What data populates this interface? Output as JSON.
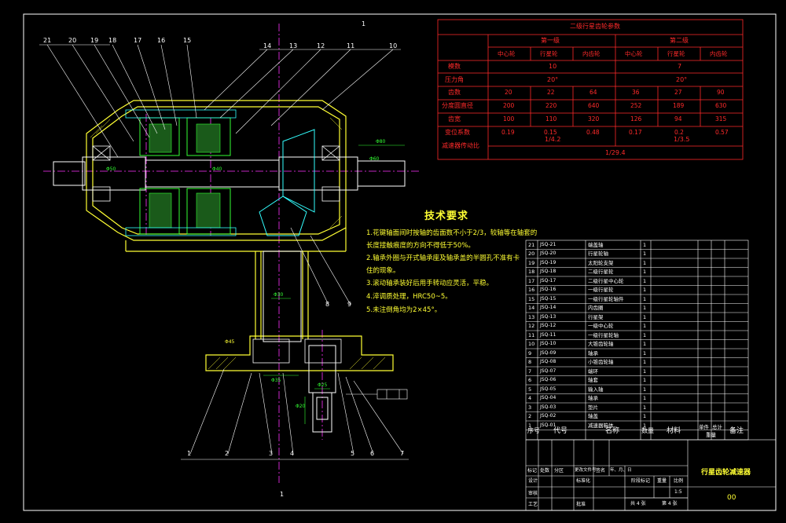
{
  "colors": {
    "background": "#000000",
    "frame": "#ffffff",
    "red": "#ff2a2a",
    "yellow": "#ffff33",
    "green": "#33ff33",
    "cyan": "#33ffff",
    "magenta": "#ff33ff"
  },
  "top_mark": "1",
  "bottom_mark": "1",
  "gear_table": {
    "title": "二级行星齿轮参数",
    "stage1": "第一级",
    "stage2": "第二级",
    "sub_headers": [
      "中心轮",
      "行星轮",
      "内齿轮",
      "中心轮",
      "行星轮",
      "内齿轮"
    ],
    "rows": [
      {
        "label": "模数",
        "cells": [
          "10",
          "7"
        ]
      },
      {
        "label": "压力角",
        "cells": [
          "20°",
          "20°"
        ]
      },
      {
        "label": "齿数",
        "cells": [
          "20",
          "22",
          "64",
          "36",
          "27",
          "90"
        ]
      },
      {
        "label": "分度圆直径",
        "cells": [
          "200",
          "220",
          "640",
          "252",
          "189",
          "630"
        ]
      },
      {
        "label": "齿宽",
        "cells": [
          "100",
          "110",
          "320",
          "126",
          "94",
          "315"
        ]
      },
      {
        "label": "变位系数",
        "cells": [
          "0.19",
          "0.15",
          "0.48",
          "0.17",
          "0.2",
          "0.57"
        ]
      }
    ],
    "ratio_label": "减速器传动比",
    "ratio_stage1": "1/4.2",
    "ratio_stage2": "1/3.5",
    "ratio_total": "1/29.4"
  },
  "tech": {
    "title": "技术要求",
    "lines": [
      "1.花键轴面间时按轴的齿面数不小于2/3，较轴等在轴套的",
      "长度接触痕度的方向不得低于50%。",
      "2.轴承外圈与开式轴承座及轴承盖的半圆孔不准有卡",
      "住的现象。",
      "3.滚动轴承装好后用手转动应灵活，平稳。",
      "4.淬调质处理，HRC50~5。",
      "5.未注倒角均为2×45°。"
    ]
  },
  "callouts_top": [
    "21",
    "20",
    "19",
    "18",
    "17",
    "16",
    "15",
    "14",
    "13",
    "12",
    "11",
    "10"
  ],
  "callouts_bottom": [
    "1",
    "2",
    "3",
    "4",
    "5",
    "6",
    "7"
  ],
  "callouts_mid": [
    "8",
    "9"
  ],
  "bom": [
    {
      "no": "21",
      "code": "JSQ-21",
      "name": "端盖轴",
      "qty": "1"
    },
    {
      "no": "20",
      "code": "JSQ-20",
      "name": "行星轮轴",
      "qty": "1"
    },
    {
      "no": "19",
      "code": "JSQ-19",
      "name": "太阳轮支架",
      "qty": "1"
    },
    {
      "no": "18",
      "code": "JSQ-18",
      "name": "二级行星轮",
      "qty": "1"
    },
    {
      "no": "17",
      "code": "JSQ-17",
      "name": "二级行星中心轮",
      "qty": "1"
    },
    {
      "no": "16",
      "code": "JSQ-16",
      "name": "一级行星轮",
      "qty": "1"
    },
    {
      "no": "15",
      "code": "JSQ-15",
      "name": "一级行星轮轴件",
      "qty": "1"
    },
    {
      "no": "14",
      "code": "JSQ-14",
      "name": "内齿圈",
      "qty": "1"
    },
    {
      "no": "13",
      "code": "JSQ-13",
      "name": "行星架",
      "qty": "1"
    },
    {
      "no": "12",
      "code": "JSQ-12",
      "name": "一级中心轮",
      "qty": "1"
    },
    {
      "no": "11",
      "code": "JSQ-11",
      "name": "一级行星轮轴",
      "qty": "1"
    },
    {
      "no": "10",
      "code": "JSQ-10",
      "name": "大锥齿轮轴",
      "qty": "1"
    },
    {
      "no": "9",
      "code": "JSQ-09",
      "name": "轴承",
      "qty": "1"
    },
    {
      "no": "8",
      "code": "JSQ-08",
      "name": "小锥齿轮轴",
      "qty": "1"
    },
    {
      "no": "7",
      "code": "JSQ-07",
      "name": "端环",
      "qty": "1"
    },
    {
      "no": "6",
      "code": "JSQ-06",
      "name": "轴套",
      "qty": "1"
    },
    {
      "no": "5",
      "code": "JSQ-05",
      "name": "输入轴",
      "qty": "1"
    },
    {
      "no": "4",
      "code": "JSQ-04",
      "name": "轴承",
      "qty": "1"
    },
    {
      "no": "3",
      "code": "JSQ-03",
      "name": "垫片",
      "qty": "1"
    },
    {
      "no": "2",
      "code": "JSQ-02",
      "name": "轴盖",
      "qty": "1"
    },
    {
      "no": "1",
      "code": "JSQ-01",
      "name": "减速器箱体",
      "qty": "1"
    }
  ],
  "bom_header": {
    "no": "序号",
    "code": "代号",
    "name": "名称",
    "qty": "数量",
    "material": "材料",
    "unit_weight": "单件",
    "total_weight": "总计",
    "weight": "重量",
    "remark": "备注"
  },
  "title_block": {
    "drawing_name": "行星齿轮减速器",
    "drawing_no": "00",
    "rev_row": [
      "标记",
      "处数",
      "分区",
      "更改文件号",
      "签名",
      "年、月、日"
    ],
    "design": "设计",
    "standard": "标准化",
    "stage_mark": "阶段标记",
    "weight": "重量",
    "scale": "比例",
    "scale_val": "1:5",
    "review": "审核",
    "process": "工艺",
    "approve": "批准",
    "sheets": "共 4 张",
    "sheet_no": "第 4 张"
  },
  "dims": [
    "Φ80",
    "Φ50",
    "Φ40",
    "Φ60",
    "Φ30",
    "Φ35",
    "Φ25",
    "Φ45",
    "Φ20"
  ]
}
